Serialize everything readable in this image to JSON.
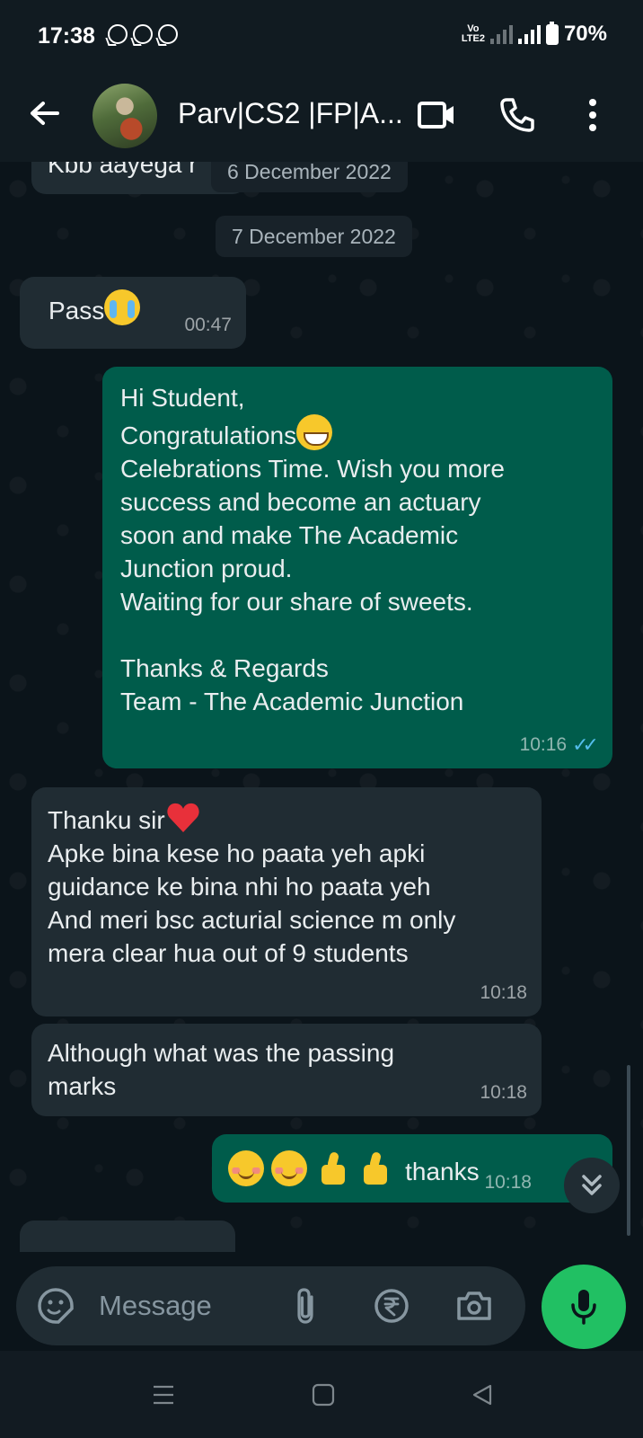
{
  "status_bar": {
    "time": "17:38",
    "app_icons": [
      "whatsapp-icon",
      "whatsapp-business-icon",
      "whatsapp-icon"
    ],
    "network_label_top": "Vo",
    "network_label_bottom": "LTE2",
    "battery": "70%"
  },
  "header": {
    "contact_name": "Parv|CS2 |FP|A...",
    "icons": [
      "back-arrow-icon",
      "video-call-icon",
      "voice-call-icon",
      "more-options-icon"
    ]
  },
  "chat": {
    "partial_message": "Kbb aayega r",
    "date_chip_1": "6 December 2022",
    "date_chip_2": "7 December 2022",
    "messages": [
      {
        "direction": "in",
        "text": "Pass",
        "emoji": "loudly-crying-face",
        "time": "00:47"
      },
      {
        "direction": "out",
        "line1": "Hi Student,",
        "line2": "Congratulations",
        "emoji": "grinning-face",
        "body": "Celebrations Time. Wish you more\nsuccess and become an actuary\nsoon and make The Academic\nJunction proud.\nWaiting for our share of sweets.\n\nThanks & Regards\nTeam - The Academic Junction",
        "time": "10:16",
        "status": "read"
      },
      {
        "direction": "in",
        "line1": "Thanku sir",
        "emoji": "red-heart",
        "body": "Apke bina kese ho paata yeh apki\nguidance ke bina nhi ho paata yeh\nAnd meri bsc acturial science m only\nmera clear hua out of 9 students",
        "time": "10:18"
      },
      {
        "direction": "in",
        "text": "Although what was the passing\nmarks",
        "time": "10:18"
      },
      {
        "direction": "out",
        "emojis": [
          "smiling-face-with-blush",
          "smiling-face-with-blush",
          "thumbs-up",
          "thumbs-up"
        ],
        "text": "thanks",
        "time": "10:18"
      }
    ]
  },
  "input": {
    "placeholder": "Message",
    "icons": [
      "sticker-icon",
      "attachment-icon",
      "rupee-payment-icon",
      "camera-icon",
      "mic-icon"
    ]
  },
  "colors": {
    "background": "#0b141a",
    "incoming_bubble": "#202c33",
    "outgoing_bubble": "#005c4b",
    "accent_green": "#21c063",
    "read_tick": "#53bdeb"
  }
}
